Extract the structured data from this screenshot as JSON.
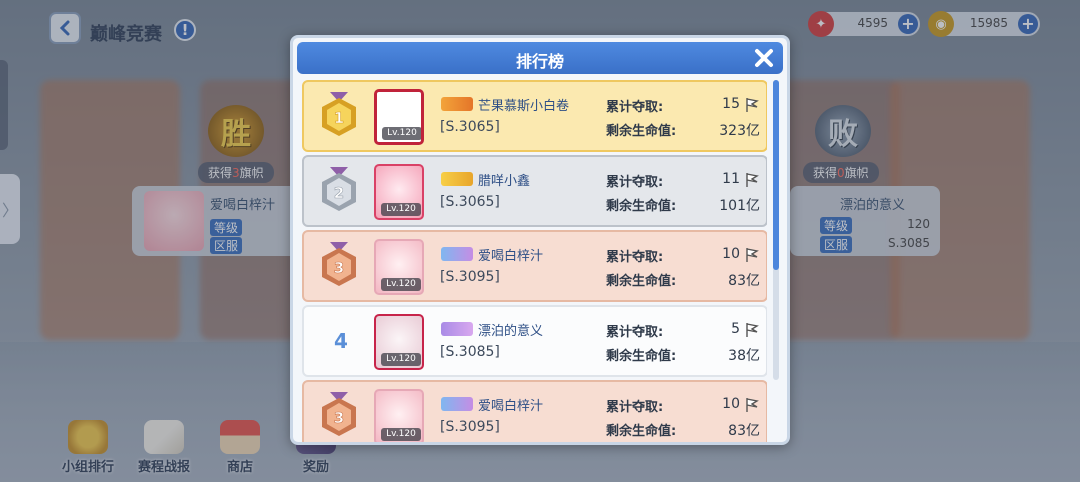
{
  "header": {
    "back_icon": "back-arrow-icon",
    "title": "巅峰竞赛",
    "help_label": "!"
  },
  "currencies": [
    {
      "icon": "red-gem-icon",
      "value": "4595",
      "color": "#d43d3d"
    },
    {
      "icon": "gold-coin-icon",
      "value": "15985",
      "color": "#c99a1e"
    }
  ],
  "left_team": {
    "badge": "胜",
    "flag_prefix": "获得",
    "flag_count": "3",
    "flag_suffix": "旗帜",
    "name": "爱喝白梓汁",
    "level_label": "等级",
    "server_label": "区服"
  },
  "right_team": {
    "badge": "败",
    "flag_prefix": "获得",
    "flag_count": "0",
    "flag_suffix": "旗帜",
    "name": "漂泊的意义",
    "level_label": "等级",
    "level_value": "120",
    "server_label": "区服",
    "server_value": "S.3085"
  },
  "side_tab": "〉",
  "bottom_menu": [
    {
      "icon": "group-rank-icon",
      "label": "小组排行"
    },
    {
      "icon": "battle-report-icon",
      "label": "赛程战报"
    },
    {
      "icon": "shop-icon",
      "label": "商店"
    },
    {
      "icon": "reward-icon",
      "label": "奖励"
    }
  ],
  "modal": {
    "title": "排行榜",
    "close_icon": "close-icon",
    "captured_label": "累计夺取:",
    "hp_label": "剩余生命值:",
    "rows": [
      {
        "rank": "1",
        "tier": "gold",
        "level": "Lv.120",
        "name": "芒果慕斯小白卷",
        "server": "[S.3065]",
        "captured": "15",
        "hp": "323亿"
      },
      {
        "rank": "2",
        "tier": "silver",
        "level": "Lv.120",
        "name": "腊咩小鑫",
        "server": "[S.3065]",
        "captured": "11",
        "hp": "101亿"
      },
      {
        "rank": "3",
        "tier": "bronze",
        "level": "Lv.120",
        "name": "爱喝白梓汁",
        "server": "[S.3095]",
        "captured": "10",
        "hp": "83亿"
      },
      {
        "rank": "4",
        "tier": "plain",
        "level": "Lv.120",
        "name": "漂泊的意义",
        "server": "[S.3085]",
        "captured": "5",
        "hp": "38亿"
      },
      {
        "rank": "3",
        "tier": "bronze",
        "level": "Lv.120",
        "name": "爱喝白梓汁",
        "server": "[S.3095]",
        "captured": "10",
        "hp": "83亿"
      }
    ]
  }
}
